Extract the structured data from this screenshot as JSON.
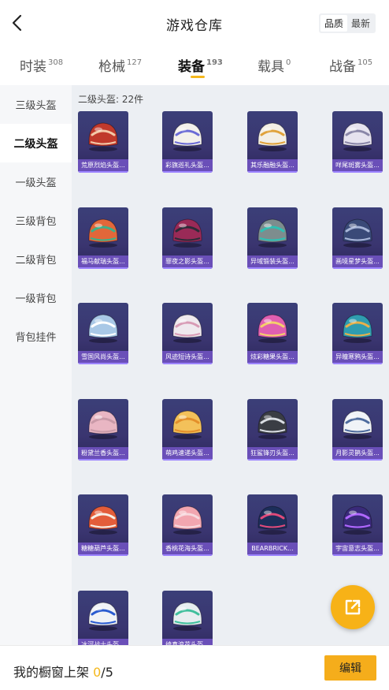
{
  "header": {
    "title": "游戏仓库",
    "sort_options": [
      "品质",
      "最新"
    ],
    "sort_active": 0
  },
  "tabs": [
    {
      "label": "时装",
      "count": "308"
    },
    {
      "label": "枪械",
      "count": "127"
    },
    {
      "label": "装备",
      "count": "193"
    },
    {
      "label": "载具",
      "count": "0"
    },
    {
      "label": "战备",
      "count": "105"
    }
  ],
  "active_tab": 2,
  "sidebar": {
    "items": [
      {
        "label": "三级头盔"
      },
      {
        "label": "二级头盔"
      },
      {
        "label": "一级头盔"
      },
      {
        "label": "三级背包"
      },
      {
        "label": "二级背包"
      },
      {
        "label": "一级背包"
      },
      {
        "label": "背包挂件"
      }
    ],
    "active": 1
  },
  "section": {
    "label": "二级头盔: 22件"
  },
  "items": [
    {
      "name": "荒原烈焰头盔...",
      "color": "#c0392b",
      "accent": "#f3c9a8"
    },
    {
      "name": "彩旗巡礼头盔...",
      "color": "#f4f1ec",
      "accent": "#6b6bd6"
    },
    {
      "name": "其乐融融头盔...",
      "color": "#f3efe6",
      "accent": "#e0a23a"
    },
    {
      "name": "咩尾斑雾头盔...",
      "color": "#e6e3ef",
      "accent": "#8a87a8"
    },
    {
      "name": "福马献瑞头盔...",
      "color": "#e2673a",
      "accent": "#3bb28a"
    },
    {
      "name": "罪夜之影头盔...",
      "color": "#9a2a57",
      "accent": "#2c2c38"
    },
    {
      "name": "异域锻装头盔...",
      "color": "#7d8d8e",
      "accent": "#2ec1b4"
    },
    {
      "name": "画境星梦头盔...",
      "color": "#3a4a78",
      "accent": "#a8b6d8"
    },
    {
      "name": "雪国风尚头盔...",
      "color": "#a9c8e6",
      "accent": "#ffffff"
    },
    {
      "name": "风迹短诗头盔...",
      "color": "#efe9ee",
      "accent": "#d89bb5"
    },
    {
      "name": "炫彩糖果头盔...",
      "color": "#e05fb1",
      "accent": "#f4d06a"
    },
    {
      "name": "异瞳寒鸦头盔...",
      "color": "#2f9db0",
      "accent": "#e8b04a"
    },
    {
      "name": "粉黛兰香头盔...",
      "color": "#e9b6c3",
      "accent": "#c99aa8"
    },
    {
      "name": "萌鸡速递头盔...",
      "color": "#f3c15a",
      "accent": "#e48f2a"
    },
    {
      "name": "狂鲨锋刃头盔...",
      "color": "#3a3d44",
      "accent": "#d9dde3"
    },
    {
      "name": "月影灵鹊头盔...",
      "color": "#f0f3f7",
      "accent": "#4f6c9e"
    },
    {
      "name": "糖糖葫芦头盔...",
      "color": "#e35d3a",
      "accent": "#f6efe6"
    },
    {
      "name": "香桃花海头盔...",
      "color": "#f2a6b0",
      "accent": "#f7d9de"
    },
    {
      "name": "BEARBRICK...",
      "color": "#1c2e5a",
      "accent": "#e04a7a"
    },
    {
      "name": "宇宙意志头盔...",
      "color": "#3a2a7a",
      "accent": "#b168ff"
    },
    {
      "name": "冰河战士头盔...",
      "color": "#f0f2f6",
      "accent": "#2a5bd0"
    },
    {
      "name": "绮真浪花头盔...",
      "color": "#e7eef0",
      "accent": "#3fbf9c"
    }
  ],
  "footer": {
    "label": "我的橱窗上架",
    "current": "0",
    "total": "/5",
    "edit_label": "编辑"
  }
}
